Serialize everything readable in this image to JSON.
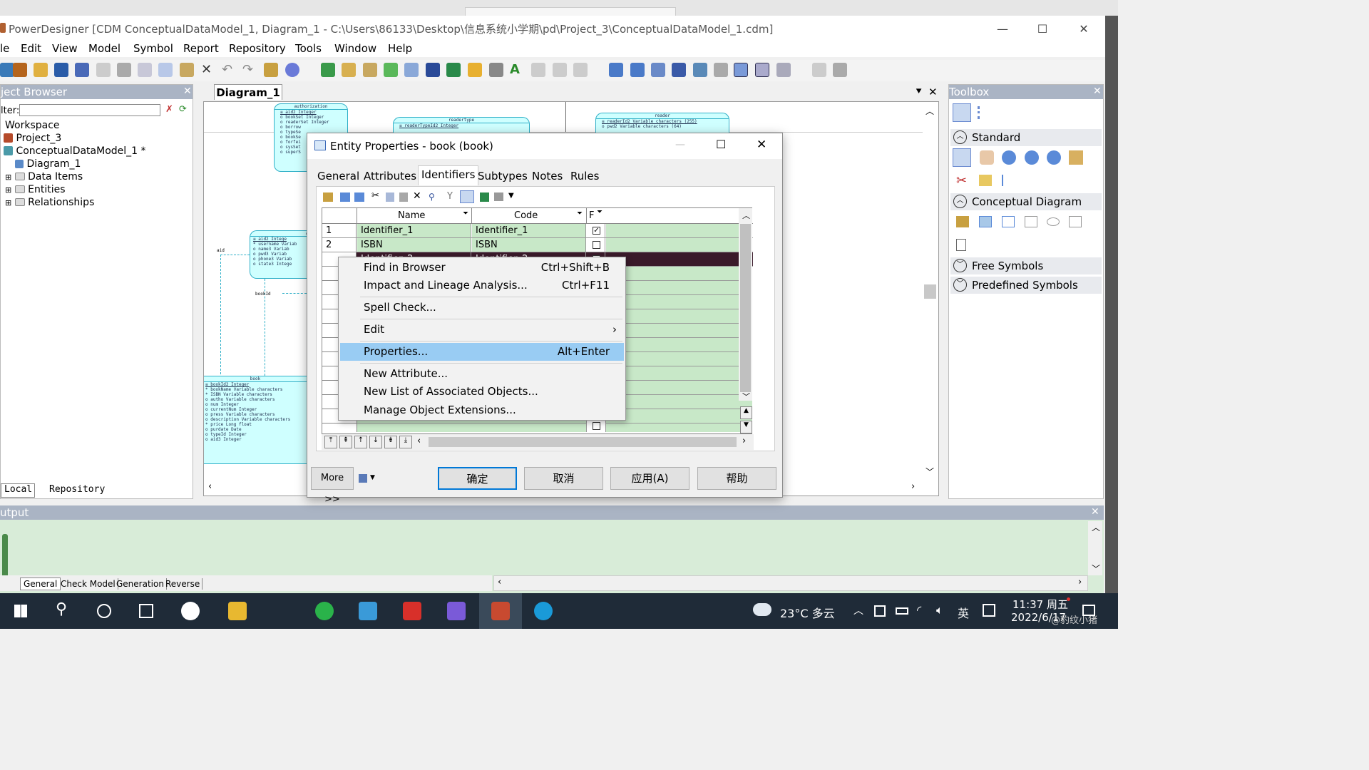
{
  "window": {
    "title": "PowerDesigner [CDM ConceptualDataModel_1, Diagram_1 - C:\\Users\\86133\\Desktop\\信息系统小学期\\pd\\Project_3\\ConceptualDataModel_1.cdm]"
  },
  "menu": [
    "le",
    "Edit",
    "View",
    "Model",
    "Symbol",
    "Report",
    "Repository",
    "Tools",
    "Window",
    "Help"
  ],
  "object_browser": {
    "title": "ject Browser",
    "filter_label": "lter:",
    "filter_value": "",
    "tree": [
      "Workspace",
      "Project_3",
      "ConceptualDataModel_1 *",
      "Diagram_1",
      "Data Items",
      "Entities",
      "Relationships"
    ],
    "tabs": [
      "Local",
      "Repository"
    ]
  },
  "diagram": {
    "tab": "Diagram_1",
    "entities": {
      "authorization": {
        "name": "authorization",
        "rows": [
          "≡  aid2      Integer",
          "o  bookSet   Integer",
          "o  readerSet Integer",
          "o  borrow",
          "o  typeSe",
          "o  bookSe",
          "o  forfei",
          "o  sysSet",
          "o  superS"
        ]
      },
      "readertype": {
        "name": "readertype",
        "rows": [
          "≡  readerTypeId2   Integer"
        ]
      },
      "reader": {
        "name": "reader",
        "rows": [
          "≡  readerId2    Variable characters (255)",
          "o  pwd2        Variable characters (64)"
        ]
      },
      "admin": {
        "name": "ad",
        "rows": [
          "≡  aid2      Intege",
          "*  username  Variab",
          "o  name3     Variab",
          "o  pwd3      Variab",
          "o  phone3    Variab",
          "o  state3    Intege"
        ]
      },
      "book": {
        "name": "book",
        "rows": [
          "≡ bookId2      Integer",
          "* bookName     Variable characters",
          "* ISBN         Variable characters",
          "o autho        Variable characters",
          "o num          Integer",
          "o currentNum   Integer",
          "o press        Variable characters",
          "o description  Variable characters",
          "* price        Long float",
          "o purdate      Date",
          "o typeId       Integer",
          "o aid3         Integer"
        ]
      }
    },
    "labels": {
      "aid": "aid",
      "bookId": "bookId"
    }
  },
  "toolbox": {
    "title": "Toolbox",
    "sections": [
      "Standard",
      "Conceptual Diagram",
      "Free Symbols",
      "Predefined Symbols"
    ]
  },
  "output": {
    "title": "utput",
    "tabs": [
      "General",
      "Check Model",
      "Generation",
      "Reverse"
    ]
  },
  "dialog": {
    "title": "Entity Properties - book (book)",
    "tabs": [
      "General",
      "Attributes",
      "Identifiers",
      "Subtypes",
      "Notes",
      "Rules"
    ],
    "active_tab": "Identifiers",
    "columns": [
      "Name",
      "Code",
      "F"
    ],
    "rows": [
      {
        "num": "1",
        "name": "Identifier_1",
        "code": "Identifier_1",
        "checked": true
      },
      {
        "num": "2",
        "name": "ISBN",
        "code": "ISBN",
        "checked": false
      },
      {
        "num": "",
        "name": "Identifier_2",
        "code": "Identifier_2",
        "checked": false
      }
    ],
    "more_label": "More >>",
    "buttons": {
      "ok": "确定",
      "cancel": "取消",
      "apply": "应用(A)",
      "help": "帮助"
    }
  },
  "context_menu": {
    "items": [
      {
        "label": "Find in Browser",
        "shortcut": "Ctrl+Shift+B"
      },
      {
        "label": "Impact and Lineage Analysis...",
        "shortcut": "Ctrl+F11"
      },
      {
        "label": "Spell Check...",
        "shortcut": ""
      },
      {
        "label": "Edit",
        "shortcut": "›"
      },
      {
        "label": "Properties...",
        "shortcut": "Alt+Enter"
      },
      {
        "label": "New Attribute...",
        "shortcut": ""
      },
      {
        "label": "New List of Associated Objects...",
        "shortcut": ""
      },
      {
        "label": "Manage Object Extensions...",
        "shortcut": ""
      }
    ],
    "highlighted": "Properties..."
  },
  "taskbar": {
    "weather": "23°C 多云",
    "ime": "英",
    "time": "11:37 周五",
    "date": "2022/6/17",
    "watermark": "@豹纹小猪"
  }
}
